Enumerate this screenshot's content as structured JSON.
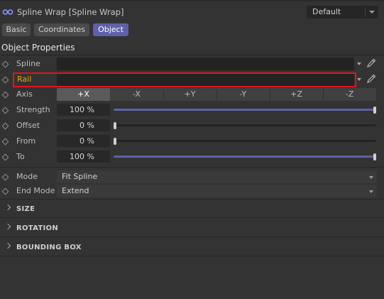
{
  "header": {
    "title": "Spline Wrap [Spline Wrap]",
    "icon": "spline-wrap-icon",
    "preset": "Default"
  },
  "tabs": [
    {
      "label": "Basic",
      "active": false
    },
    {
      "label": "Coordinates",
      "active": false
    },
    {
      "label": "Object",
      "active": true
    }
  ],
  "section_title": "Object Properties",
  "fields": {
    "spline": {
      "label": "Spline",
      "value": ""
    },
    "rail": {
      "label": "Rail",
      "value": ""
    }
  },
  "axis": {
    "label": "Axis",
    "options": [
      "+X",
      "-X",
      "+Y",
      "-Y",
      "+Z",
      "-Z"
    ],
    "selected": "+X"
  },
  "sliders": [
    {
      "label": "Strength",
      "value": "100 %",
      "fraction": 1.0
    },
    {
      "label": "Offset",
      "value": "0 %",
      "fraction": 0.0
    },
    {
      "label": "From",
      "value": "0 %",
      "fraction": 0.0
    },
    {
      "label": "To",
      "value": "100 %",
      "fraction": 1.0
    }
  ],
  "dropdowns": [
    {
      "label": "Mode",
      "value": "Fit Spline"
    },
    {
      "label": "End Mode",
      "value": "Extend"
    }
  ],
  "groups": [
    "SIZE",
    "ROTATION",
    "BOUNDING BOX"
  ],
  "colors": {
    "accent": "#5e61a8",
    "highlight_border": "#e3141c",
    "rail_text": "#f0a400"
  }
}
